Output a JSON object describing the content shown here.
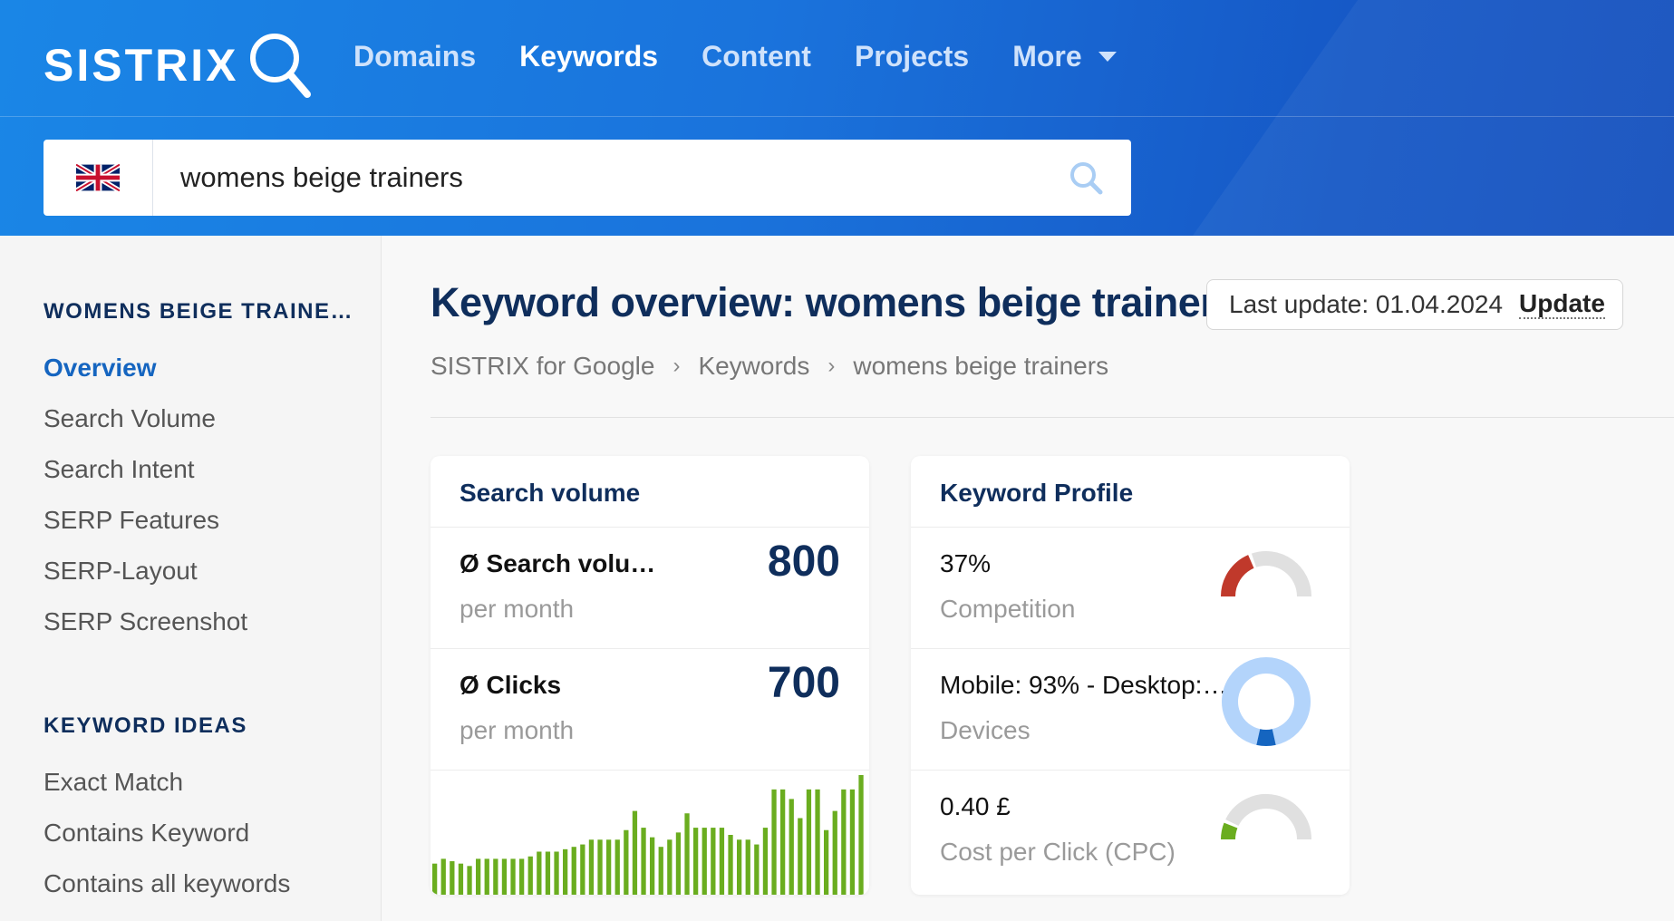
{
  "brand": {
    "logo_text": "SISTRIX"
  },
  "nav": {
    "items": [
      {
        "label": "Domains",
        "active": false
      },
      {
        "label": "Keywords",
        "active": true
      },
      {
        "label": "Content",
        "active": false
      },
      {
        "label": "Projects",
        "active": false
      },
      {
        "label": "More",
        "active": false
      }
    ]
  },
  "search": {
    "country_flag": "uk-flag-icon",
    "value": "womens beige trainers"
  },
  "sidebar": {
    "section1": {
      "heading": "WOMENS BEIGE TRAINE…",
      "items": [
        {
          "label": "Overview",
          "active": true
        },
        {
          "label": "Search Volume"
        },
        {
          "label": "Search Intent"
        },
        {
          "label": "SERP Features"
        },
        {
          "label": "SERP-Layout"
        },
        {
          "label": "SERP Screenshot"
        }
      ]
    },
    "section2": {
      "heading": "KEYWORD IDEAS",
      "items": [
        {
          "label": "Exact Match"
        },
        {
          "label": "Contains Keyword"
        },
        {
          "label": "Contains all keywords"
        }
      ]
    }
  },
  "page": {
    "title": "Keyword overview: womens beige trainers",
    "last_update": "Last update: 01.04.2024",
    "update_label": "Update",
    "breadcrumb": [
      "SISTRIX for Google",
      "Keywords",
      "womens beige trainers"
    ]
  },
  "search_volume_card": {
    "title": "Search volume",
    "rows": [
      {
        "label": "Ø Search volu…",
        "sub": "per month",
        "value": "800"
      },
      {
        "label": "Ø Clicks",
        "sub": "per month",
        "value": "700"
      }
    ],
    "bars": [
      26,
      30,
      28,
      26,
      24,
      30,
      30,
      30,
      30,
      30,
      30,
      32,
      36,
      36,
      36,
      38,
      40,
      42,
      46,
      46,
      46,
      46,
      54,
      70,
      56,
      48,
      40,
      46,
      52,
      68,
      56,
      56,
      56,
      56,
      50,
      46,
      46,
      42,
      56,
      88,
      88,
      80,
      64,
      88,
      88,
      54,
      70,
      88,
      88,
      100
    ]
  },
  "keyword_profile_card": {
    "title": "Keyword Profile",
    "rows": [
      {
        "value": "37%",
        "sub": "Competition",
        "gauge_fraction": 0.37,
        "color": "#c0392b"
      },
      {
        "value": "Mobile: 93% - Desktop:…",
        "sub": "Devices",
        "mobile_fraction": 0.93,
        "color_main": "#b3d4fb",
        "color_accent": "#1565c0"
      },
      {
        "value": "0.40 £",
        "sub": "Cost per Click (CPC)",
        "gauge_fraction": 0.12,
        "color": "#6aad1f"
      }
    ]
  },
  "colors": {
    "header_blue": "#1a73dc",
    "title_navy": "#0f2e5c",
    "link_blue": "#1565c0",
    "bar_green": "#6aad1f",
    "gauge_track": "#e0e0e0"
  }
}
